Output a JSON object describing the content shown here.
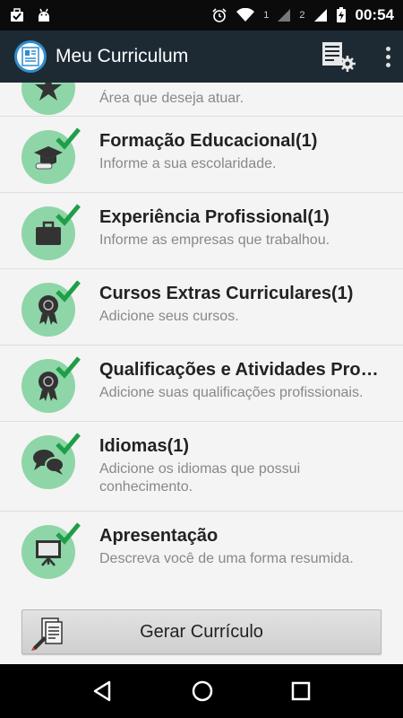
{
  "status_bar": {
    "sim1": "1",
    "sim2": "2",
    "time": "00:54"
  },
  "app_bar": {
    "title": "Meu Curriculum"
  },
  "list_items": [
    {
      "title": "",
      "subtitle": "Área que deseja atuar.",
      "icon": "star-icon",
      "checked": false
    },
    {
      "title": "Formação Educacional(1)",
      "subtitle": "Informe a sua escolaridade.",
      "icon": "graduation-cap-icon",
      "checked": true
    },
    {
      "title": "Experiência Profissional(1)",
      "subtitle": "Informe as empresas que trabalhou.",
      "icon": "briefcase-icon",
      "checked": true
    },
    {
      "title": "Cursos Extras Curriculares(1)",
      "subtitle": "Adicione seus cursos.",
      "icon": "award-ribbon-icon",
      "checked": true
    },
    {
      "title": "Qualificações e Atividades Pro…",
      "subtitle": "Adicione suas qualificações profissionais.",
      "icon": "award-ribbon-icon",
      "checked": true
    },
    {
      "title": "Idiomas(1)",
      "subtitle": "Adicione os idiomas que possui conhecimento.",
      "icon": "chat-bubbles-icon",
      "checked": true
    },
    {
      "title": "Apresentação",
      "subtitle": "Descreva você de uma forma resumida.",
      "icon": "presentation-board-icon",
      "checked": true
    }
  ],
  "generate_button": {
    "label": "Gerar Currículo"
  },
  "colors": {
    "status_bar": "#0b0b0b",
    "app_bar": "#1d2a33",
    "icon_circle": "#8ed6a7",
    "check": "#1f9e48",
    "background": "#f4f4f4"
  }
}
